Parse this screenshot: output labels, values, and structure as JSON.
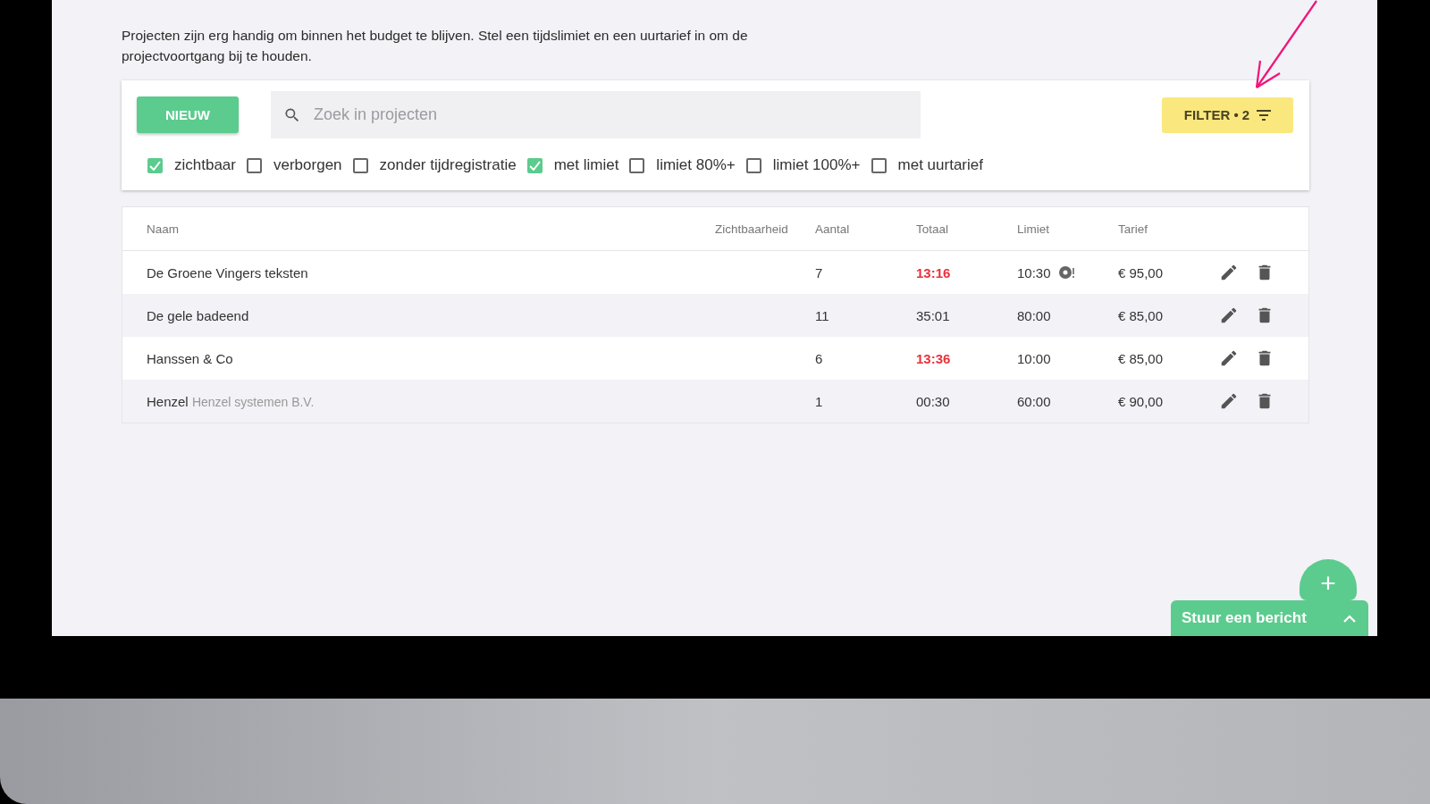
{
  "intro": "Projecten zijn erg handig om binnen het budget te blijven. Stel een tijdslimiet en een uurtarief in om de projectvoortgang bij te houden.",
  "toolbar": {
    "new_button": "NIEUW",
    "search": {
      "placeholder": "Zoek in projecten"
    },
    "filter_button": "FILTER • 2"
  },
  "filters": [
    {
      "label": "zichtbaar",
      "checked": true
    },
    {
      "label": "verborgen",
      "checked": false
    },
    {
      "label": "zonder tijdregistratie",
      "checked": false
    },
    {
      "label": "met limiet",
      "checked": true
    },
    {
      "label": "limiet 80%+",
      "checked": false
    },
    {
      "label": "limiet 100%+",
      "checked": false
    },
    {
      "label": "met uurtarief",
      "checked": false
    }
  ],
  "table": {
    "columns": [
      "Naam",
      "Zichtbaarheid",
      "Aantal",
      "Totaal",
      "Limiet",
      "Tarief"
    ],
    "rows": [
      {
        "name": "De Groene Vingers teksten",
        "count": "7",
        "total": "13:16",
        "over_limit": true,
        "limit": "10:30",
        "warning": true,
        "rate": "€ 95,00"
      },
      {
        "name": "De gele badeend",
        "count": "11",
        "total": "35:01",
        "over_limit": false,
        "limit": "80:00",
        "warning": false,
        "rate": "€ 85,00"
      },
      {
        "name": "Hanssen & Co",
        "count": "6",
        "total": "13:36",
        "over_limit": true,
        "limit": "10:00",
        "warning": false,
        "rate": "€ 85,00"
      },
      {
        "name": "Henzel",
        "client": "Henzel systemen B.V.",
        "count": "1",
        "total": "00:30",
        "over_limit": false,
        "limit": "60:00",
        "warning": false,
        "rate": "€ 90,00"
      }
    ]
  },
  "fab": "+",
  "chat": {
    "label": "Stuur een bericht"
  }
}
